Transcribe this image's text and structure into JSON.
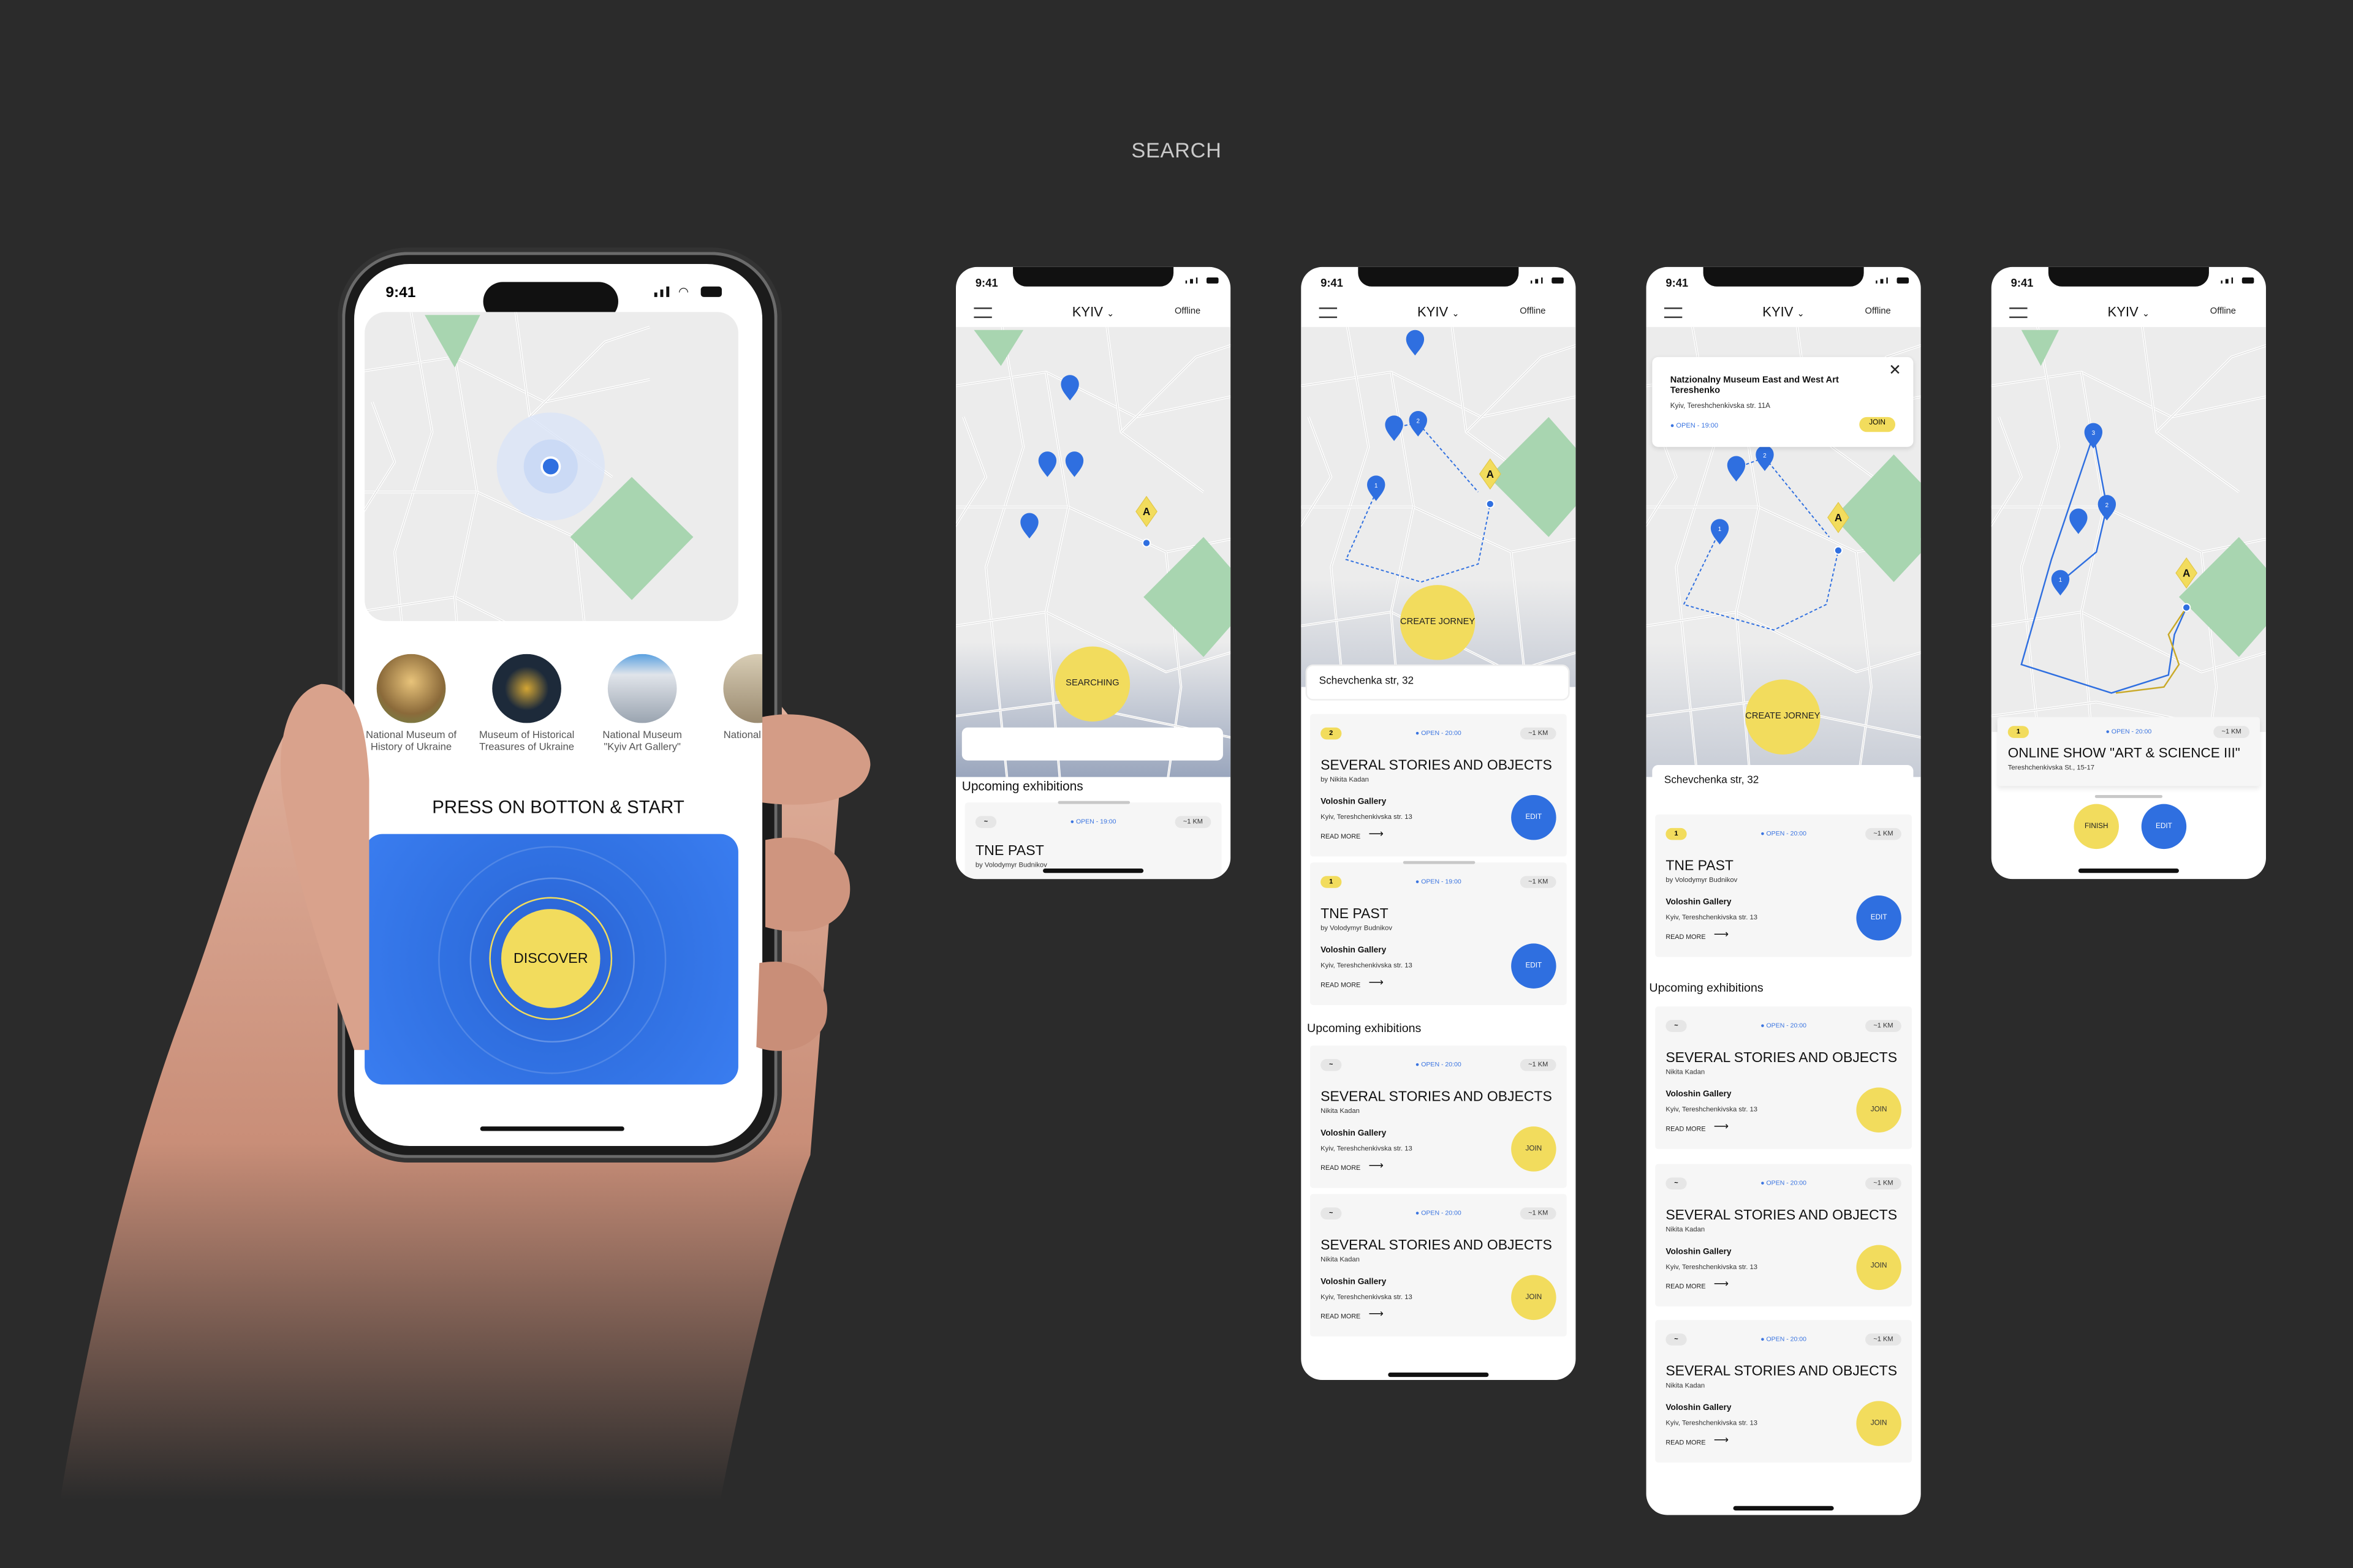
{
  "page_title": "SEARCH",
  "status_time": "9:41",
  "colors": {
    "accent_blue": "#2f6fe0",
    "accent_yellow": "#f2dc5d",
    "map_green": "#a8d5b0",
    "background": "#2b2b2b"
  },
  "header": {
    "city": "KYIV",
    "status": "Offline",
    "menu_icon": "hamburger-icon",
    "dropdown_icon": "chevron-down-icon"
  },
  "main_phone": {
    "museums": [
      {
        "label": "National Museum of History of Ukraine"
      },
      {
        "label": "Museum of Historical Treasures of Ukraine"
      },
      {
        "label": "National Museum \"Kyiv Art Gallery\""
      },
      {
        "label": "National and M"
      }
    ],
    "prompt": "PRESS ON BOTTON & START",
    "discover": "DISCOVER"
  },
  "screen_searching": {
    "button": "SEARCHING",
    "search_value": "",
    "section": "Upcoming exhibitions",
    "cards": [
      {
        "badge": "~",
        "open": "OPEN - 19:00",
        "distance": "~1 KM",
        "title": "TNE PAST",
        "author": "by Volodymyr Budnikov"
      }
    ]
  },
  "screen_journey": {
    "button": "CREATE JORNEY",
    "search_value": "Schevchenka str, 32",
    "section": "Upcoming exhibitions",
    "selected": [
      {
        "badge": "2",
        "open": "OPEN - 20:00",
        "distance": "~1 KM",
        "title": "SEVERAL STORIES AND OBJECTS",
        "author": "by Nikita Kadan",
        "venue": "Voloshin Gallery",
        "address": "Kyiv, Tereshchenkivska str. 13",
        "read_more": "READ MORE",
        "action": "EDIT"
      },
      {
        "badge": "1",
        "open": "OPEN - 19:00",
        "distance": "~1 KM",
        "title": "TNE PAST",
        "author": "by Volodymyr Budnikov",
        "venue": "Voloshin Gallery",
        "address": "Kyiv, Tereshchenkivska str. 13",
        "read_more": "READ MORE",
        "action": "EDIT"
      }
    ],
    "upcoming": [
      {
        "badge": "~",
        "open": "OPEN - 20:00",
        "distance": "~1 KM",
        "title": "SEVERAL STORIES AND OBJECTS",
        "author": "Nikita Kadan",
        "venue": "Voloshin Gallery",
        "address": "Kyiv, Tereshchenkivska str. 13",
        "read_more": "READ MORE",
        "action": "JOIN"
      },
      {
        "badge": "~",
        "open": "OPEN - 20:00",
        "distance": "~1 KM",
        "title": "SEVERAL STORIES AND OBJECTS",
        "author": "Nikita Kadan",
        "venue": "Voloshin Gallery",
        "address": "Kyiv, Tereshchenkivska str. 13",
        "read_more": "READ MORE",
        "action": "JOIN"
      }
    ]
  },
  "screen_popup": {
    "popup": {
      "title": "Natzionalny Museum East and West Art Tereshenko",
      "address": "Kyiv, Tereshchenkivska str. 11A",
      "open": "OPEN - 19:00",
      "action": "JOIN"
    },
    "button": "CREATE JORNEY",
    "search_value": "Schevchenka str, 32",
    "section": "Upcoming exhibitions",
    "selected": [
      {
        "badge": "1",
        "open": "OPEN - 20:00",
        "distance": "~1 KM",
        "title": "TNE PAST",
        "author": "by Volodymyr Budnikov",
        "venue": "Voloshin Gallery",
        "address": "Kyiv, Tereshchenkivska str. 13",
        "read_more": "READ MORE",
        "action": "EDIT"
      }
    ],
    "upcoming": [
      {
        "badge": "~",
        "open": "OPEN - 20:00",
        "distance": "~1 KM",
        "title": "SEVERAL STORIES AND OBJECTS",
        "author": "Nikita Kadan",
        "venue": "Voloshin Gallery",
        "address": "Kyiv, Tereshchenkivska str. 13",
        "read_more": "READ MORE",
        "action": "JOIN"
      },
      {
        "badge": "~",
        "open": "OPEN - 20:00",
        "distance": "~1 KM",
        "title": "SEVERAL STORIES AND OBJECTS",
        "author": "Nikita Kadan",
        "venue": "Voloshin Gallery",
        "address": "Kyiv, Tereshchenkivska str. 13",
        "read_more": "READ MORE",
        "action": "JOIN"
      },
      {
        "badge": "~",
        "open": "OPEN - 20:00",
        "distance": "~1 KM",
        "title": "SEVERAL STORIES AND OBJECTS",
        "author": "Nikita Kadan",
        "venue": "Voloshin Gallery",
        "address": "Kyiv, Tereshchenkivska str. 13",
        "read_more": "READ MORE",
        "action": "JOIN"
      }
    ]
  },
  "screen_route": {
    "card": {
      "badge": "1",
      "open": "OPEN - 20:00",
      "distance": "~1 KM",
      "title": "ONLINE SHOW \"ART & SCIENCE III\"",
      "address": "Tereshchenkivska St., 15-17"
    },
    "finish": "FINISH",
    "edit": "EDIT"
  },
  "pins": {
    "destination_label": "A"
  }
}
